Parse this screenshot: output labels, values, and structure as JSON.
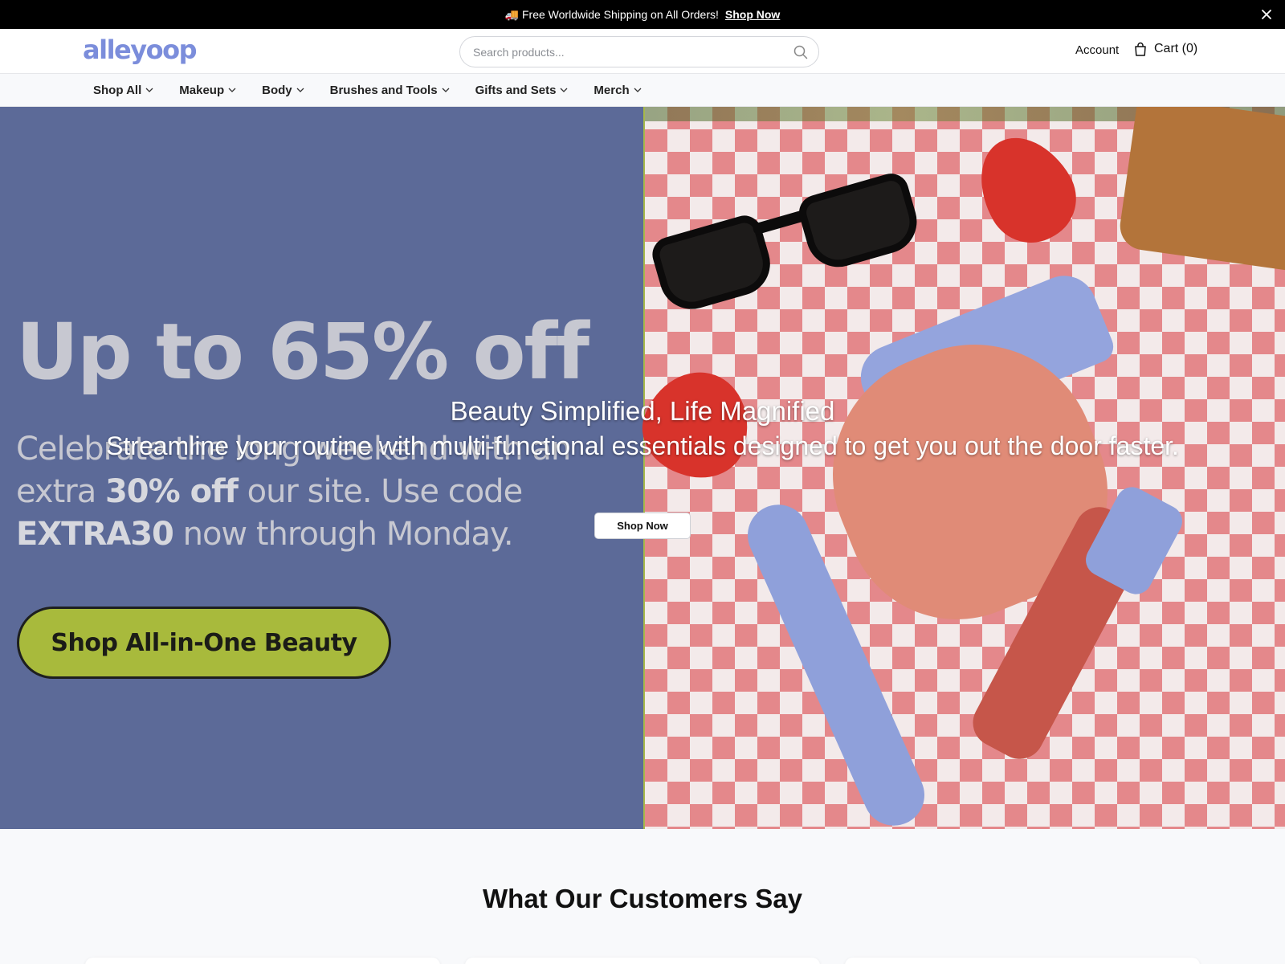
{
  "announcement": {
    "icon": "truck-icon",
    "text": "🚚 Free Worldwide Shipping on All Orders!",
    "link": "Shop Now"
  },
  "header": {
    "logo": "alleyoop",
    "search_placeholder": "Search products...",
    "account_label": "Account",
    "cart_label": "Cart (0)"
  },
  "nav": {
    "items": [
      "Shop All",
      "Makeup",
      "Body",
      "Brushes and Tools",
      "Gifts and Sets",
      "Merch"
    ]
  },
  "hero": {
    "promo_headline": "Up to 65% off",
    "promo_copy_1": "Celebrate the long weekend with an extra ",
    "promo_copy_bold_1": "30% off",
    "promo_copy_2": " our site. Use code ",
    "promo_copy_bold_2": "EXTRA30",
    "promo_copy_3": " now through Monday.",
    "promo_cta": "Shop All-in-One Beauty",
    "title": "Beauty Simplified, Life Magnified",
    "subtitle": "Streamline your routine with multi-functional essentials designed to get you out the door faster.",
    "button": "Shop Now"
  },
  "reviews": {
    "title": "What Our Customers Say"
  },
  "colors": {
    "brand": "#7b8ddb",
    "hero_left": "#5c6a98",
    "cta_green": "#a8ba3c",
    "gingham_red": "#d7373c"
  }
}
